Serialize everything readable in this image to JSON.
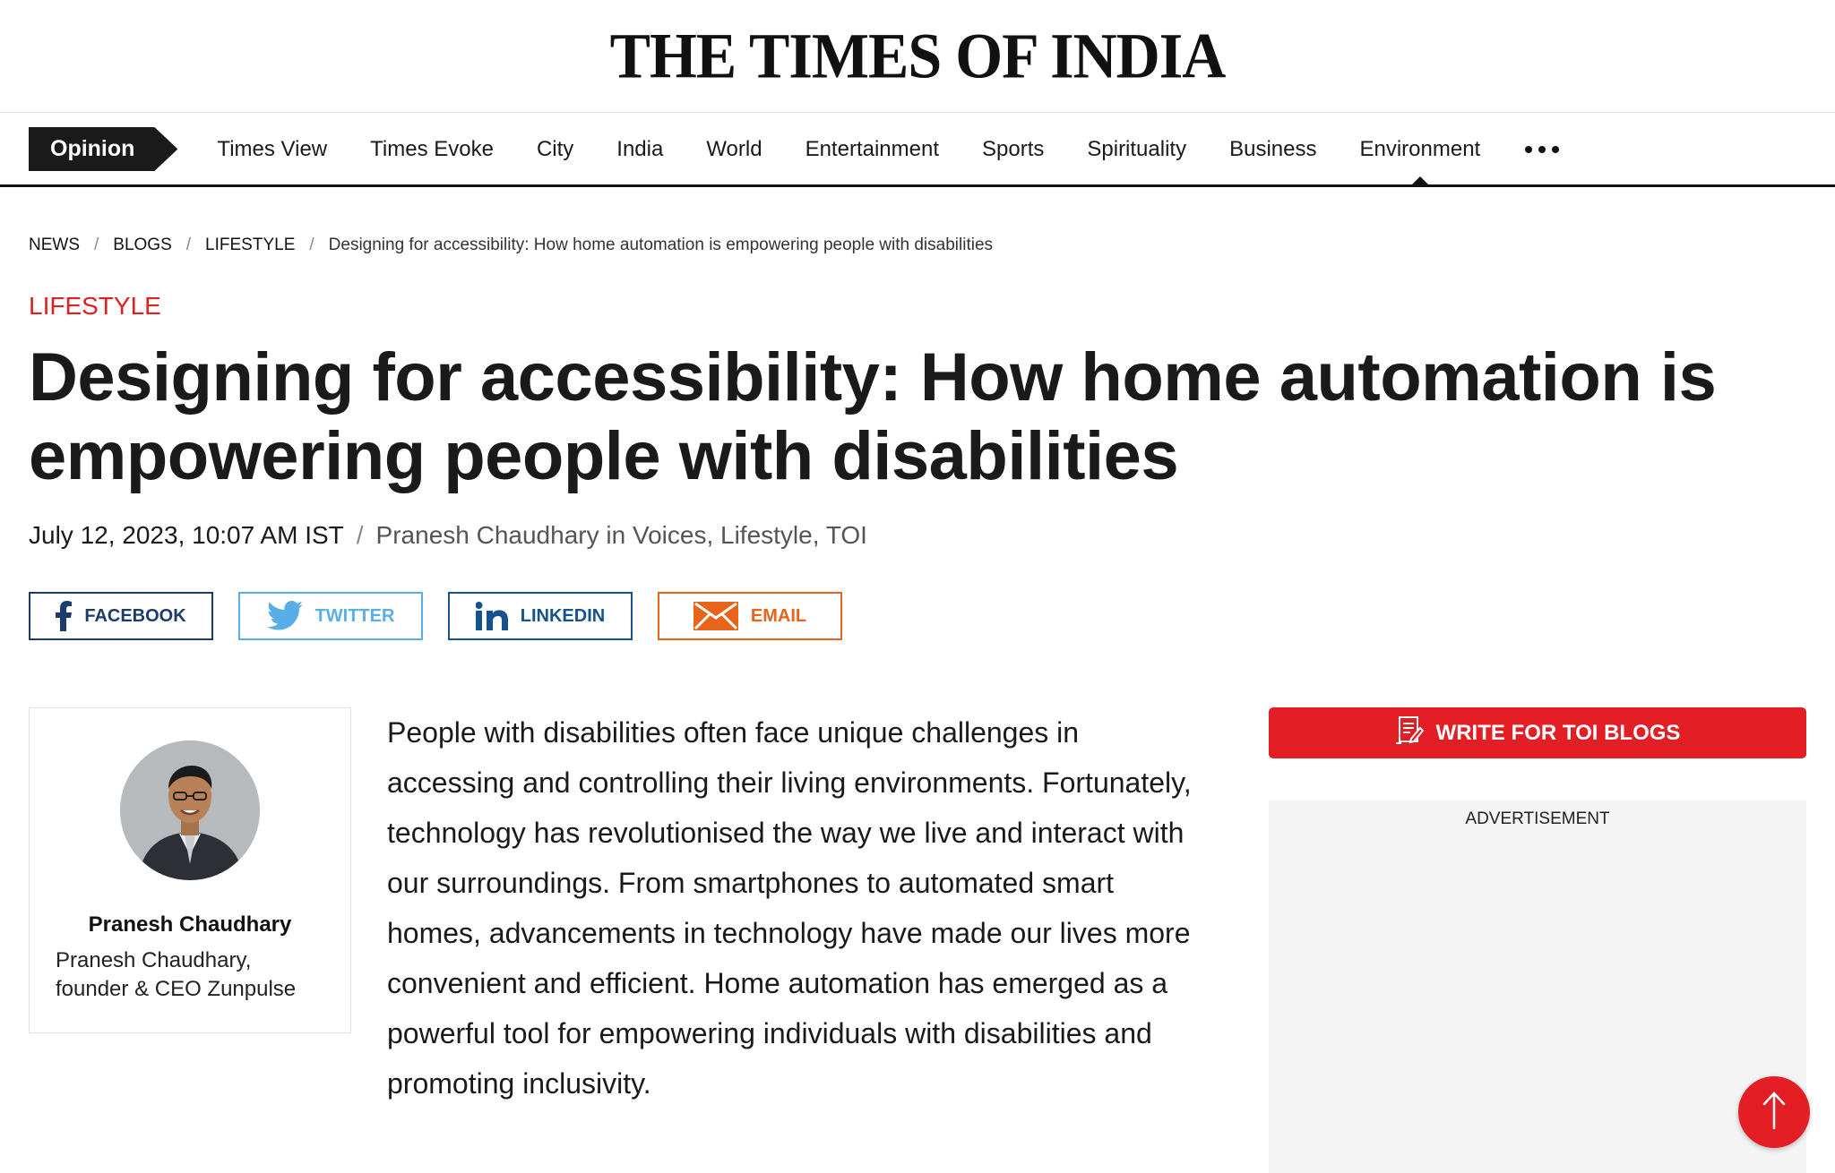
{
  "site": {
    "logo_text": "THE TIMES OF INDIA"
  },
  "nav": {
    "opinion_label": "Opinion",
    "items": [
      {
        "label": "Times View"
      },
      {
        "label": "Times Evoke"
      },
      {
        "label": "City"
      },
      {
        "label": "India"
      },
      {
        "label": "World"
      },
      {
        "label": "Entertainment"
      },
      {
        "label": "Sports"
      },
      {
        "label": "Spirituality"
      },
      {
        "label": "Business"
      },
      {
        "label": "Environment"
      }
    ],
    "active_item": "Environment",
    "more_icon": "more-horizontal-icon"
  },
  "breadcrumb": {
    "items": [
      "NEWS",
      "BLOGS",
      "LIFESTYLE"
    ],
    "current": "Designing for accessibility: How home automation is empowering people with disabilities",
    "separator": "/"
  },
  "article": {
    "section": "LIFESTYLE",
    "headline": "Designing for accessibility: How home automation is empowering people with disabilities",
    "date": "July 12, 2023, 10:07 AM IST",
    "meta_separator": "/",
    "byline": "Pranesh Chaudhary in Voices, Lifestyle, TOI",
    "body": "People with disabilities often face unique challenges in accessing and controlling their living environments. Fortunately, technology has revolutionised the way we live and interact with our surroundings. From smartphones to automated smart homes, advancements in technology have made our lives more convenient and efficient. Home automation has emerged as a powerful tool for empowering individuals with disabilities and promoting inclusivity."
  },
  "share": {
    "facebook": {
      "label": "FACEBOOK",
      "icon": "facebook-icon",
      "color": "#1d3b6b"
    },
    "twitter": {
      "label": "TWITTER",
      "icon": "twitter-icon",
      "color": "#5aaee8"
    },
    "linkedin": {
      "label": "LINKEDIN",
      "icon": "linkedin-icon",
      "color": "#14538d"
    },
    "email": {
      "label": "EMAIL",
      "icon": "email-icon",
      "color": "#e8641a"
    }
  },
  "author": {
    "name": "Pranesh Chaudhary",
    "title": "Pranesh Chaudhary, founder & CEO Zunpulse"
  },
  "sidebar": {
    "write_button_label": "WRITE FOR TOI BLOGS",
    "write_button_icon": "write-document-icon",
    "ad_label": "ADVERTISEMENT"
  },
  "colors": {
    "accent_red": "#e31e24",
    "section_red": "#e02020",
    "nav_dark": "#1a1a1a"
  }
}
